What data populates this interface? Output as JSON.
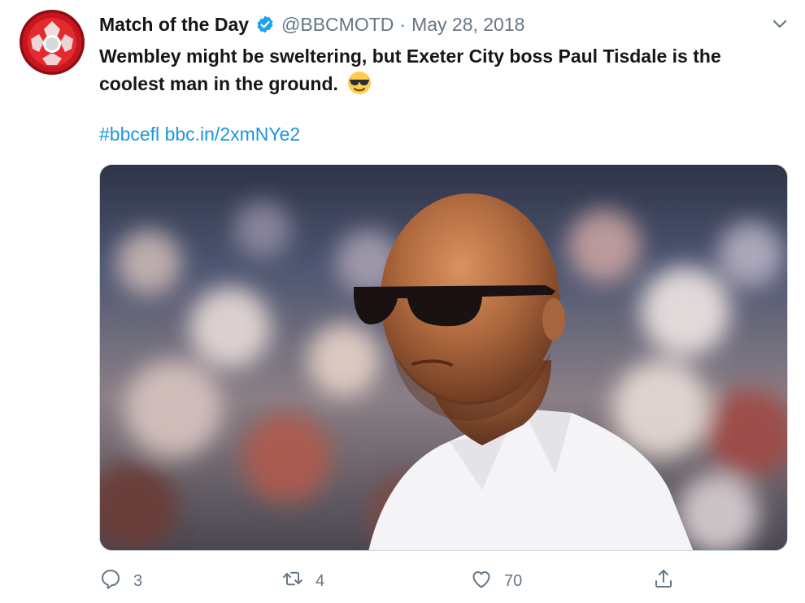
{
  "author": {
    "display_name": "Match of the Day",
    "handle": "@BBCMOTD",
    "separator": "·",
    "date": "May 28, 2018",
    "verified": true
  },
  "tweet": {
    "text": "Wembley might be sweltering, but Exeter City boss Paul Tisdale is the coolest man in the ground.",
    "emoji": "smiling-face-with-sunglasses",
    "hashtag": "#bbcefl",
    "link": "bbc.in/2xmNYe2"
  },
  "media": {
    "description_icon": "photo"
  },
  "actions": {
    "reply_count": "3",
    "retweet_count": "4",
    "like_count": "70"
  },
  "colors": {
    "text": "#14171a",
    "secondary": "#657786",
    "link": "#1b95e0",
    "verified": "#1da1f2"
  }
}
